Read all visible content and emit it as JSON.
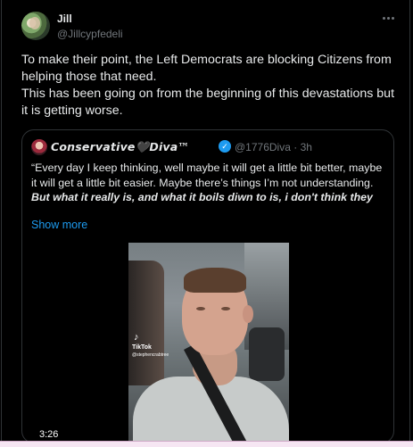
{
  "post": {
    "display_name": "Jill",
    "handle": "@Jillcypfedeli",
    "text": "To make their point, the Left Democrats are blocking Citizens from helping those that need.\nThis has been going on from the beginning of this devastations but it is getting worse."
  },
  "quote": {
    "name": "𝘾𝙤𝙣𝙨𝙚𝙧𝙫𝙖𝙩𝙞𝙫𝙚🖤𝘿𝙞𝙫𝙖™",
    "handle": "@1776Diva",
    "time": "· 3h",
    "text_plain": "“Every day I keep thinking, well maybe it will get a little bit better, maybe it will get a little bit easier. Maybe there’s things I’m not understanding. ",
    "text_emphasis": "But what it really is, and what  it boils diwn to is, i don't think they",
    "show_more": "Show more"
  },
  "video": {
    "tiktok_logo": "♪",
    "tiktok_label": "TikTok",
    "tiktok_user": "@stephencrabtree",
    "duration": "3:26"
  },
  "icons": {
    "more": "more-horizontal-icon",
    "verified": "verified-badge-icon",
    "tiktok": "tiktok-logo-icon"
  },
  "colors": {
    "background": "#000000",
    "text": "#e7e9ea",
    "secondary": "#71767b",
    "link": "#1d9bf0",
    "border": "#2f3336"
  }
}
